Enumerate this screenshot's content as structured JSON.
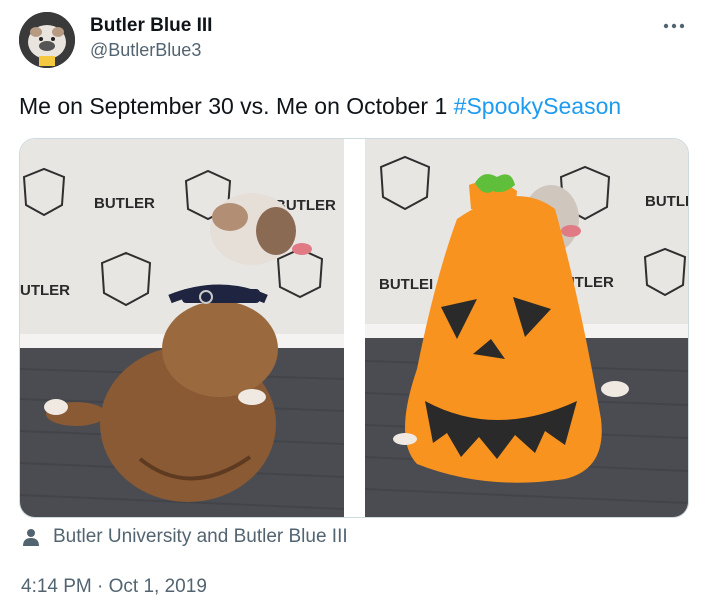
{
  "author": {
    "display_name": "Butler Blue III",
    "handle": "@ButlerBlue3",
    "avatar_icon": "bulldog-avatar-icon"
  },
  "tweet": {
    "text": "Me on September 30 vs. Me on October 1",
    "hashtag": "#SpookySeason"
  },
  "media": {
    "photo_left": {
      "backdrop_text_1": "BUTLER",
      "backdrop_text_2": "BUTLER",
      "backdrop_text_3": "UTLER",
      "subject": "bulldog-in-harness"
    },
    "photo_right": {
      "backdrop_text_1": "BUTLI",
      "backdrop_text_2": "BUTLEI",
      "backdrop_text_3": "BUTLER",
      "subject": "bulldog-in-pumpkin-costume"
    }
  },
  "tagged": {
    "icon": "person-icon",
    "text": "Butler University and Butler Blue III"
  },
  "meta": {
    "time": "4:14 PM",
    "separator": "·",
    "date": "Oct 1, 2019"
  },
  "colors": {
    "text": "#0f1419",
    "secondary": "#536471",
    "link": "#1d9bf0",
    "pumpkin": "#f7931e"
  }
}
